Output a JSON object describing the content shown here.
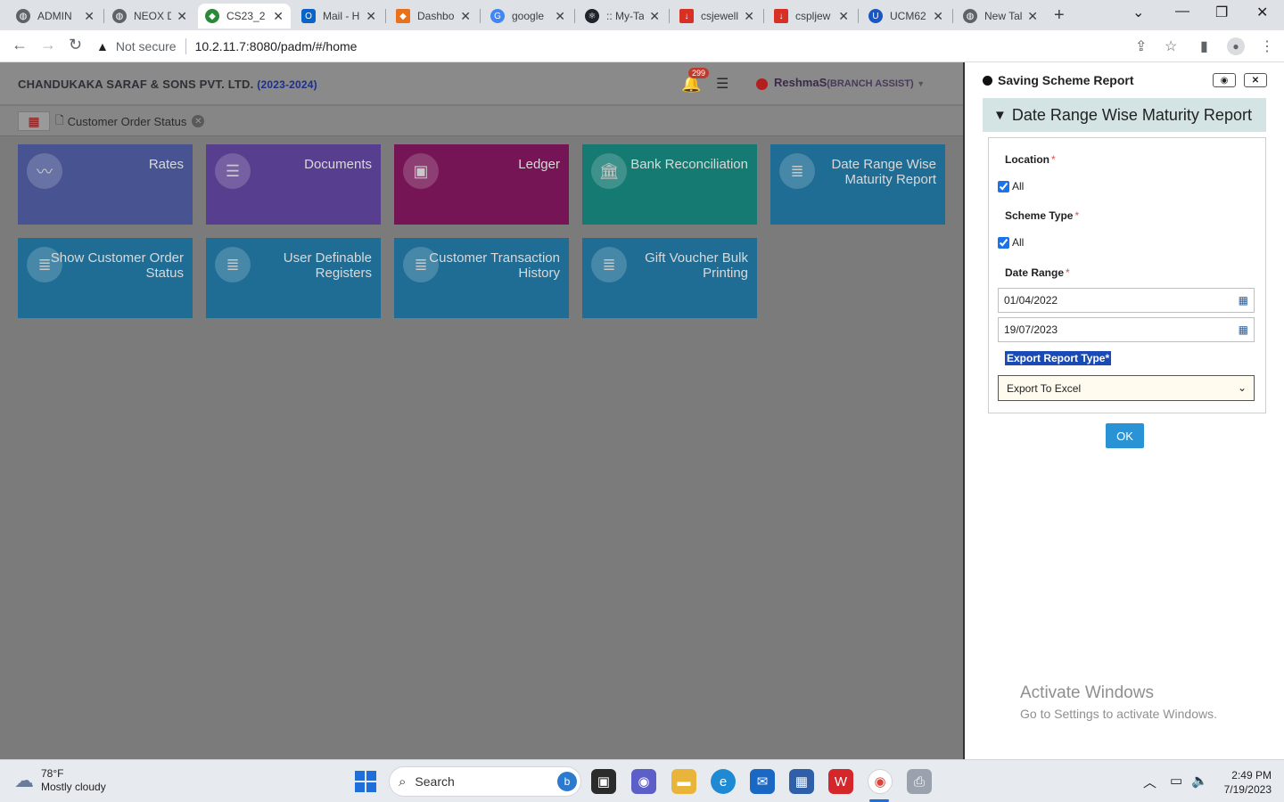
{
  "browser": {
    "tabs": [
      {
        "label": "ADMIN",
        "icon": "globe-icon",
        "color": "#5f6368"
      },
      {
        "label": "NEOX D",
        "icon": "globe-icon",
        "color": "#5f6368"
      },
      {
        "label": "CS23_2",
        "icon": "app-icon",
        "color": "#2a8a3a"
      },
      {
        "label": "Mail - H",
        "icon": "outlook-icon",
        "color": "#0a64c8"
      },
      {
        "label": "Dashbo",
        "icon": "dashboard-icon",
        "color": "#e8711a"
      },
      {
        "label": "google",
        "icon": "google-icon",
        "color": "#4285f4"
      },
      {
        "label": ":: My-Ta",
        "icon": "react-icon",
        "color": "#20232a"
      },
      {
        "label": "csjewell",
        "icon": "download-icon",
        "color": "#d93025"
      },
      {
        "label": "cspljew",
        "icon": "download-icon",
        "color": "#d93025"
      },
      {
        "label": "UCM62",
        "icon": "ucm-icon",
        "color": "#1a56c4"
      },
      {
        "label": "New Tal",
        "icon": "globe-icon",
        "color": "#5f6368"
      }
    ],
    "tab_close": "✕",
    "new_tab": "+",
    "address": {
      "warning": "Not secure",
      "url": "10.2.11.7:8080/padm/#/home"
    }
  },
  "app": {
    "company": "CHANDUKAKA SARAF & SONS PVT. LTD.",
    "year": "(2023-2024)",
    "notification_count": "299",
    "user_name": "ReshmaS",
    "user_role": "(BRANCH ASSIST)",
    "open_tab": "Customer Order Status"
  },
  "tiles": [
    {
      "label": "Rates",
      "icon": "chart-icon",
      "color": "#485492"
    },
    {
      "label": "Documents",
      "icon": "list-icon",
      "color": "#583e8e"
    },
    {
      "label": "Ledger",
      "icon": "money-icon",
      "color": "#751555"
    },
    {
      "label": "Bank Reconciliation",
      "icon": "bank-icon",
      "color": "#157b72"
    },
    {
      "label": "Date Range Wise Maturity Report",
      "icon": "server-icon",
      "color": "#1f6d95"
    },
    {
      "label": "Show Customer Order Status",
      "icon": "server-icon",
      "color": "#1f6d95"
    },
    {
      "label": "User Definable Registers",
      "icon": "server-icon",
      "color": "#1f6d95"
    },
    {
      "label": "Customer Transaction History",
      "icon": "server-icon",
      "color": "#1f6d95"
    },
    {
      "label": "Gift Voucher Bulk Printing",
      "icon": "server-icon",
      "color": "#1f6d95"
    }
  ],
  "panel": {
    "title": "Saving Scheme Report",
    "report_title": "Date Range Wise Maturity Report",
    "location_label": "Location",
    "location_all": "All",
    "scheme_label": "Scheme Type",
    "scheme_all": "All",
    "date_label": "Date Range",
    "from_date": "01/04/2022",
    "to_date": "19/07/2023",
    "export_label": "Export Report Type",
    "export_value": "Export To Excel",
    "required_mark": "*",
    "ok_label": "OK",
    "activate_title": "Activate Windows",
    "activate_sub": "Go to Settings to activate Windows."
  },
  "taskbar": {
    "temperature": "78°F",
    "weather": "Mostly cloudy",
    "search_label": "Search",
    "time": "2:49 PM",
    "date": "7/19/2023"
  }
}
